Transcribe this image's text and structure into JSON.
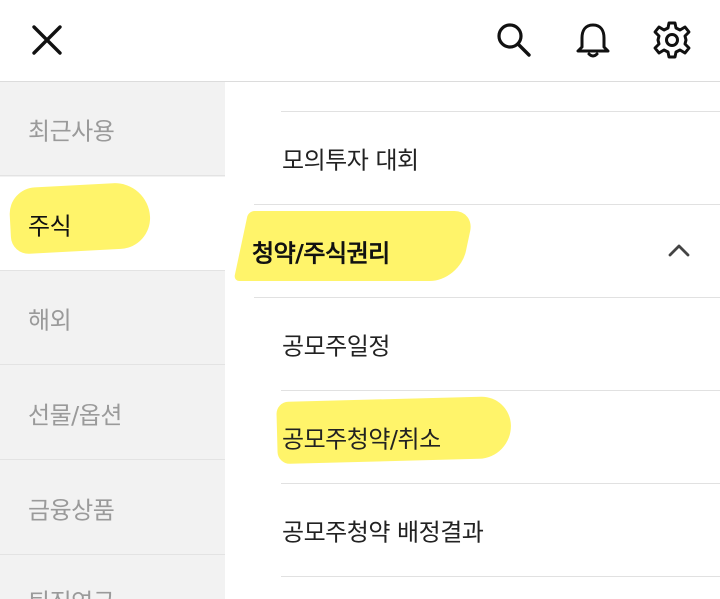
{
  "header": {
    "close_icon": "close-icon",
    "search_icon": "search-icon",
    "bell_icon": "bell-icon",
    "settings_icon": "gear-icon"
  },
  "sidebar": {
    "items": [
      {
        "label": "최근사용",
        "active": false
      },
      {
        "label": "주식",
        "active": true
      },
      {
        "label": "해외",
        "active": false
      },
      {
        "label": "선물/옵션",
        "active": false
      },
      {
        "label": "금융상품",
        "active": false
      },
      {
        "label": "퇴직연금",
        "active": false
      }
    ]
  },
  "main": {
    "items": [
      {
        "label": "모의투자 대회",
        "type": "item"
      },
      {
        "label": "청약/주식권리",
        "type": "section",
        "expanded": true
      },
      {
        "label": "공모주일정",
        "type": "item"
      },
      {
        "label": "공모주청약/취소",
        "type": "item"
      },
      {
        "label": "공모주청약 배정결과",
        "type": "item"
      }
    ]
  },
  "colors": {
    "highlight": "#fff35a",
    "sidebar_bg": "#f2f2f2",
    "divider": "#e1e1e1"
  }
}
